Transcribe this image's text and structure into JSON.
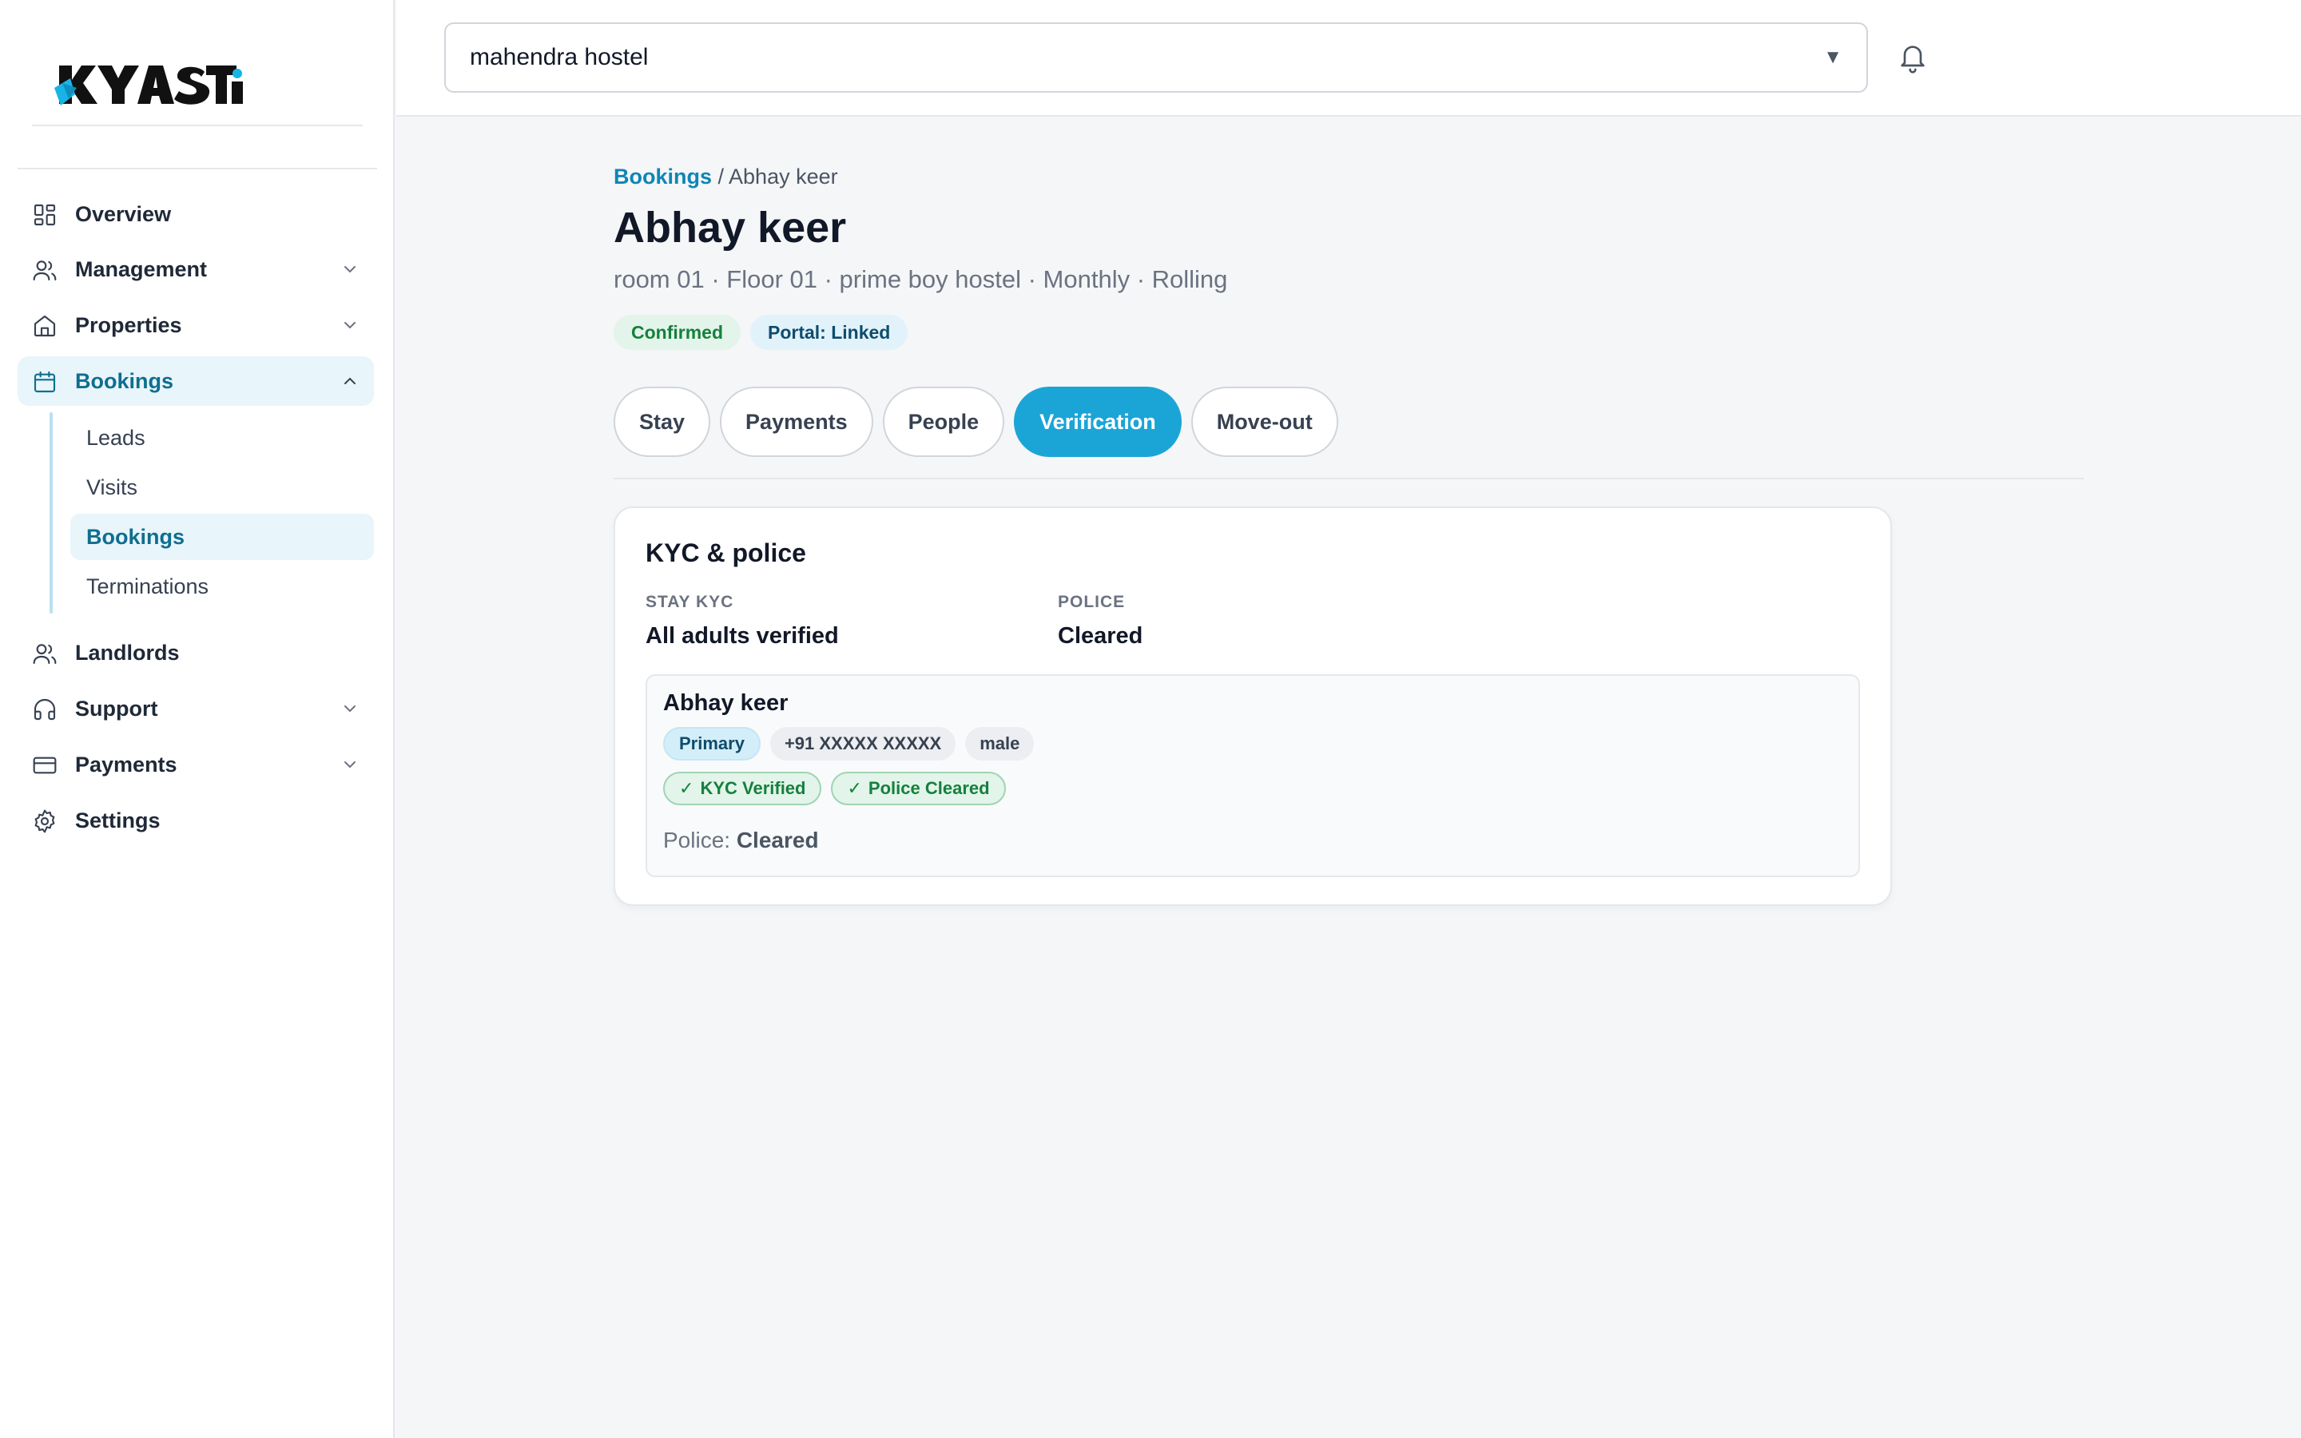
{
  "app": {
    "logo_text": "KYASTi",
    "accent_color": "#1ba5d6"
  },
  "sidebar": {
    "items": [
      {
        "label": "Overview",
        "icon": "grid-icon"
      },
      {
        "label": "Management",
        "icon": "users-icon"
      },
      {
        "label": "Properties",
        "icon": "home-icon"
      },
      {
        "label": "Bookings",
        "icon": "calendar-icon"
      },
      {
        "label": "Landlords",
        "icon": "users-icon"
      },
      {
        "label": "Support",
        "icon": "headphones-icon"
      },
      {
        "label": "Payments",
        "icon": "credit-card-icon"
      },
      {
        "label": "Settings",
        "icon": "gear-icon"
      }
    ],
    "bookings_sub": [
      {
        "label": "Leads"
      },
      {
        "label": "Visits"
      },
      {
        "label": "Bookings"
      },
      {
        "label": "Terminations"
      }
    ]
  },
  "topbar": {
    "hostel_selected": "mahendra hostel",
    "caret": "▼"
  },
  "breadcrumb": {
    "parent": "Bookings",
    "separator": " / ",
    "current": "Abhay keer"
  },
  "booking": {
    "title": "Abhay keer",
    "subtitle": "room 01 · Floor 01 · prime boy hostel · Monthly · Rolling",
    "badges": {
      "status": "Confirmed",
      "portal": "Portal: Linked"
    }
  },
  "tabs": [
    {
      "label": "Stay"
    },
    {
      "label": "Payments"
    },
    {
      "label": "People"
    },
    {
      "label": "Verification"
    },
    {
      "label": "Move-out"
    }
  ],
  "verification": {
    "card_title": "KYC & police",
    "stay_kyc_label": "STAY KYC",
    "stay_kyc_value": "All adults verified",
    "police_label": "POLICE",
    "police_value": "Cleared",
    "person": {
      "name": "Abhay keer",
      "chips": {
        "role": "Primary",
        "phone": "+91 XXXXX XXXXX",
        "gender": "male"
      },
      "status_chips": {
        "kyc": "KYC Verified",
        "police": "Police Cleared",
        "check": "✓"
      },
      "police_line_label": "Police:",
      "police_line_value": "Cleared"
    }
  }
}
